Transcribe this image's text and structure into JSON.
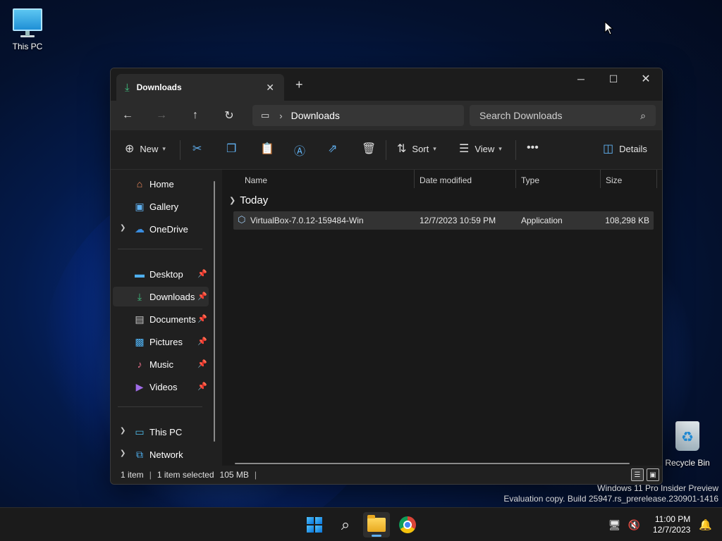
{
  "desktop": {
    "icons": [
      {
        "label": "This PC"
      },
      {
        "label": "Recycle Bin"
      }
    ]
  },
  "window": {
    "tab_title": "Downloads",
    "tab_close": "✕",
    "new_tab": "+",
    "controls": {
      "minimize": "─",
      "maximize": "☐",
      "close": "✕"
    },
    "nav": {
      "back": "←",
      "forward": "→",
      "up": "↑",
      "refresh": "↻"
    },
    "address": {
      "crumb": "Downloads"
    },
    "search": {
      "placeholder": "Search Downloads"
    },
    "commands": {
      "new": "New",
      "sort": "Sort",
      "view": "View",
      "more": "•••",
      "details": "Details"
    },
    "sidebar": {
      "items": [
        {
          "label": "Home",
          "icon": "home-icon"
        },
        {
          "label": "Gallery",
          "icon": "gallery-icon"
        },
        {
          "label": "OneDrive",
          "icon": "cloud-icon"
        },
        {
          "label": "Desktop",
          "icon": "desktop-icon"
        },
        {
          "label": "Downloads",
          "icon": "download-icon"
        },
        {
          "label": "Documents",
          "icon": "documents-icon"
        },
        {
          "label": "Pictures",
          "icon": "pictures-icon"
        },
        {
          "label": "Music",
          "icon": "music-icon"
        },
        {
          "label": "Videos",
          "icon": "videos-icon"
        },
        {
          "label": "This PC",
          "icon": "computer-icon"
        },
        {
          "label": "Network",
          "icon": "network-icon"
        }
      ]
    },
    "columns": {
      "name": "Name",
      "date": "Date modified",
      "type": "Type",
      "size": "Size"
    },
    "group": "Today",
    "files": [
      {
        "name": "VirtualBox-7.0.12-159484-Win",
        "date": "12/7/2023 10:59 PM",
        "type": "Application",
        "size": "108,298 KB"
      }
    ],
    "status": {
      "count": "1 item",
      "selected": "1 item selected",
      "size": "105 MB"
    }
  },
  "watermark": {
    "line1": "Windows 11 Pro Insider Preview",
    "line2": "Evaluation copy. Build 25947.rs_prerelease.230901-1416"
  },
  "taskbar": {
    "clock": {
      "time": "11:00 PM",
      "date": "12/7/2023"
    }
  },
  "colors": {
    "accent": "#60b0f0",
    "window_bg": "#202020",
    "selected_row": "#333333"
  }
}
